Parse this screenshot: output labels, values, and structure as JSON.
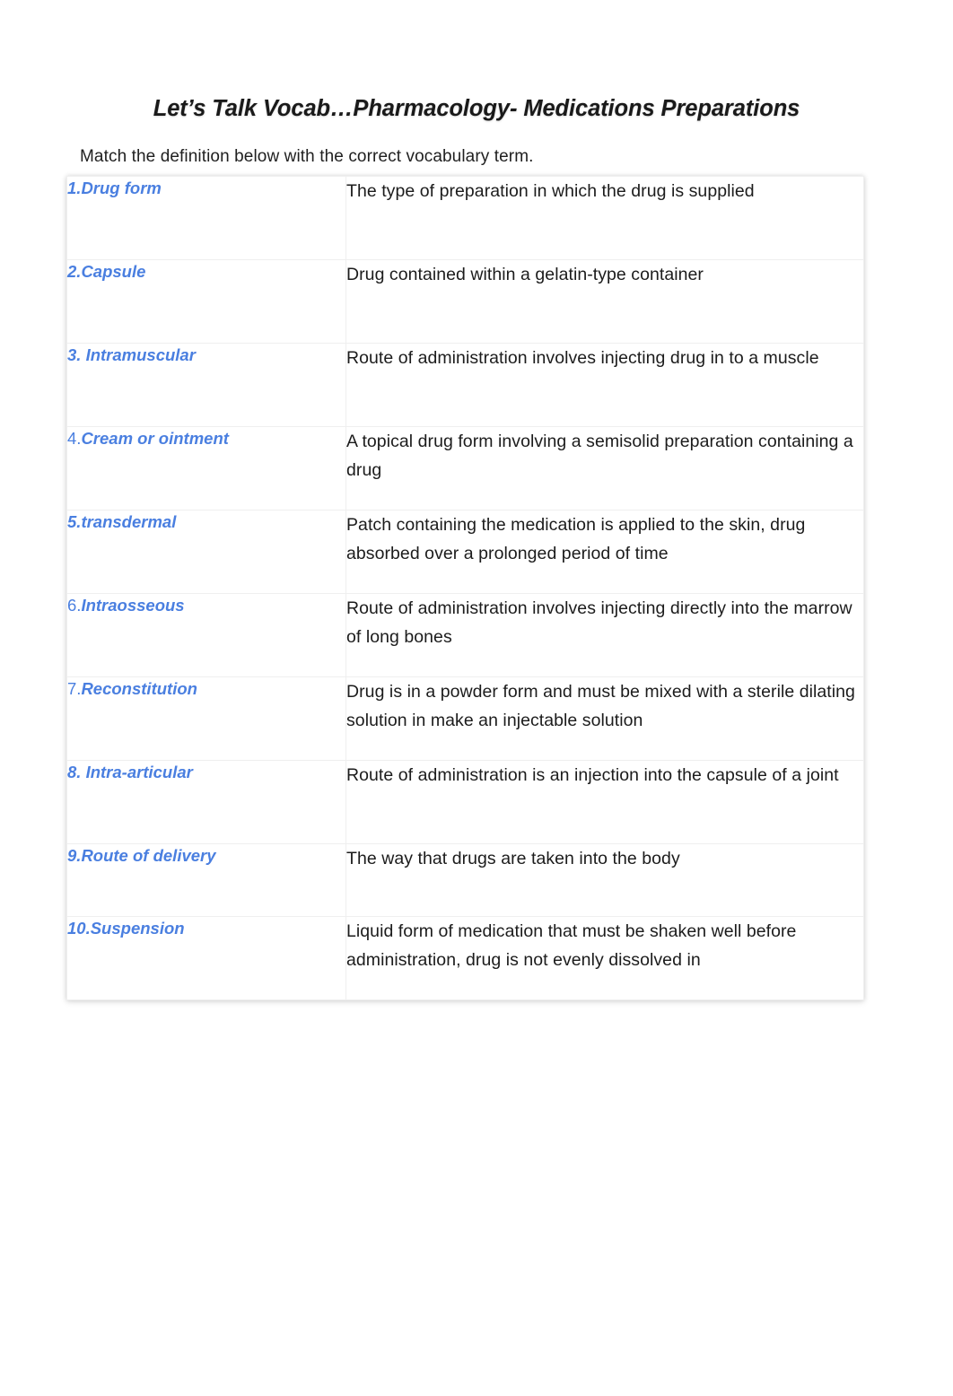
{
  "document": {
    "title": "Let’s Talk Vocab…Pharmacology- Medications Preparations",
    "instruction": "Match the definition below with the correct vocabulary term."
  },
  "colors": {
    "term_blue": "#4a7fe0",
    "definition_text": "#1c1c1c",
    "title_text": "#1a1a1a",
    "table_border": "#efefef",
    "page_background": "#ffffff"
  },
  "table": {
    "rows": [
      {
        "number": "1.",
        "number_bold": true,
        "term": "Drug form",
        "definition": "The type of preparation in which the drug is supplied"
      },
      {
        "number": "2.",
        "number_bold": true,
        "term": "Capsule",
        "definition": "Drug contained within a gelatin-type container"
      },
      {
        "number": "3. ",
        "number_bold": true,
        "term": "Intramuscular",
        "definition": "Route of administration involves injecting drug in to a muscle"
      },
      {
        "number": "4.",
        "number_bold": false,
        "term": "Cream or ointment",
        "definition": "A topical drug form involving a semisolid preparation containing a drug"
      },
      {
        "number": "5.",
        "number_bold": true,
        "term": "transdermal",
        "definition": "Patch containing the medication is applied to the skin, drug absorbed over a prolonged period of time"
      },
      {
        "number": "6.",
        "number_bold": false,
        "term": "Intraosseous",
        "definition": "Route of administration involves injecting directly into the marrow of long bones"
      },
      {
        "number": "7.",
        "number_bold": false,
        "term": "Reconstitution",
        "definition": "Drug is in a powder form and must be mixed with a sterile dilating solution in make an injectable solution"
      },
      {
        "number": "8. ",
        "number_bold": true,
        "term": "Intra-articular",
        "definition": "Route of administration is an injection into the capsule of a joint"
      },
      {
        "number": "9.",
        "number_bold": true,
        "term": "Route of delivery",
        "definition": "The way that drugs are taken into the body"
      },
      {
        "number": "10.",
        "number_bold": true,
        "term": "Suspension",
        "definition": "Liquid form of medication that must be shaken well before administration, drug is not evenly dissolved in"
      }
    ]
  }
}
